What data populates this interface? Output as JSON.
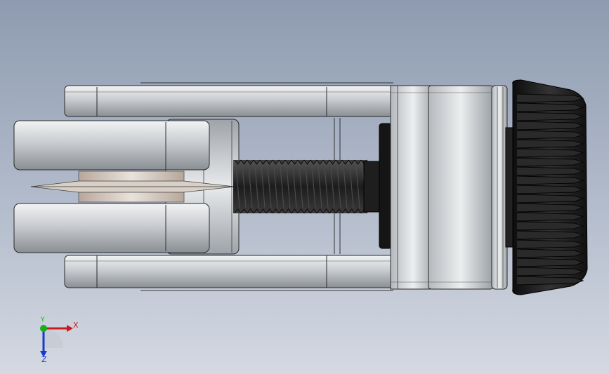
{
  "triad": {
    "x_label": "X",
    "y_label": "Y",
    "z_label": "Z",
    "x_color": "#d01818",
    "y_color": "#18b018",
    "z_color": "#1838d0"
  },
  "colors": {
    "background_top": "#8e9bb0",
    "background_bottom": "#d4d9e2",
    "metal_light": "#e6e8ea",
    "metal_mid": "#b8bcc0",
    "metal_dark": "#7b8085",
    "knob": "#1a1a1a",
    "screw": "#222222"
  }
}
